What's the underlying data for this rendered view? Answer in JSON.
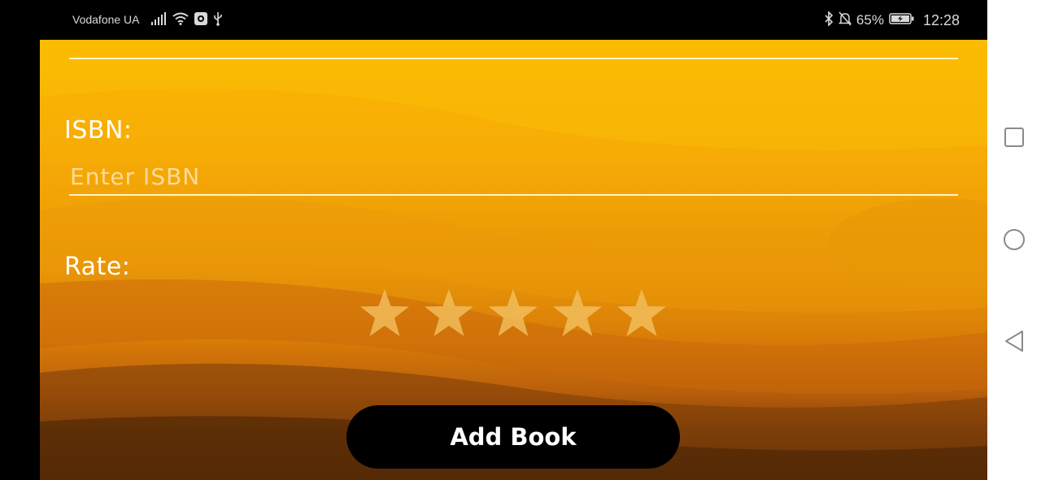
{
  "status_bar": {
    "carrier": "Vodafone UA",
    "battery_percent": "65%",
    "time": "12:28",
    "icons": [
      "signal-icon",
      "wifi-icon",
      "app-notification-icon",
      "usb-icon",
      "bluetooth-icon",
      "silent-icon",
      "battery-charging-icon"
    ]
  },
  "form": {
    "isbn_label": "ISBN:",
    "isbn_placeholder": "Enter ISBN",
    "isbn_value": "",
    "rate_label": "Rate:",
    "rating": 0,
    "rating_max": 5,
    "submit_label": "Add Book"
  },
  "nav_bar": {
    "buttons": [
      "recent-apps-icon",
      "home-icon",
      "back-icon"
    ]
  },
  "colors": {
    "background_top": "#fbb800",
    "background_bottom": "#4f2806",
    "star": "#f3c060",
    "button": "#000000",
    "text": "#ffffff"
  }
}
